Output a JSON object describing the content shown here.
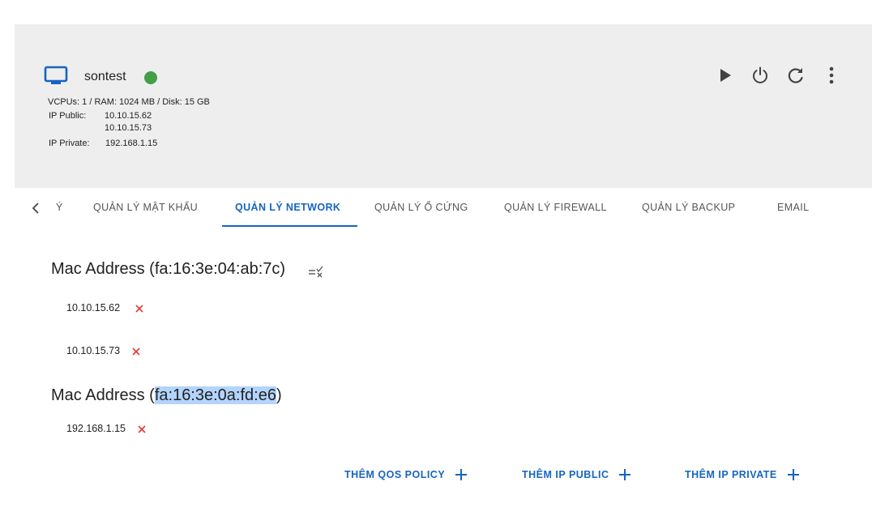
{
  "vm": {
    "name": "sontest",
    "status_color": "#43a047",
    "specs": "VCPUs: 1 / RAM: 1024 MB / Disk: 15 GB",
    "ip_public_label": "IP Public:",
    "ip_public": [
      "10.10.15.62",
      "10.10.15.73"
    ],
    "ip_private_label": "IP Private:",
    "ip_private": "192.168.1.15"
  },
  "actions": {
    "icons": [
      "play-icon",
      "power-icon",
      "refresh-icon",
      "more-vert-icon"
    ]
  },
  "tabs": {
    "items": [
      {
        "label": "Ý"
      },
      {
        "label": "QUẢN LÝ MẬT KHẨU"
      },
      {
        "label": "QUẢN LÝ NETWORK"
      },
      {
        "label": "QUẢN LÝ Ổ CỨNG"
      },
      {
        "label": "QUẢN LÝ FIREWALL"
      },
      {
        "label": "QUẢN LÝ BACKUP"
      },
      {
        "label": "EMAIL"
      }
    ],
    "active": "QUẢN LÝ NETWORK"
  },
  "network": {
    "mac1": {
      "prefix": "Mac Address (",
      "mac": "fa:16:3e:04:ab:7c",
      "suffix": ")",
      "ips": [
        "10.10.15.62",
        "10.10.15.73"
      ]
    },
    "mac2": {
      "prefix": "Mac Address (",
      "mac": "fa:16:3e:0a:fd:e6",
      "suffix": ")",
      "ips": [
        "192.168.1.15"
      ]
    }
  },
  "buttons": {
    "add_qos": "THÊM QOS POLICY",
    "add_ip_public": "THÊM IP PUBLIC",
    "add_ip_private": "THÊM IP PRIVATE"
  },
  "colors": {
    "accent": "#1565c0",
    "delete": "#e53935",
    "header_bg": "#eeeeee",
    "status": "#43a047"
  }
}
